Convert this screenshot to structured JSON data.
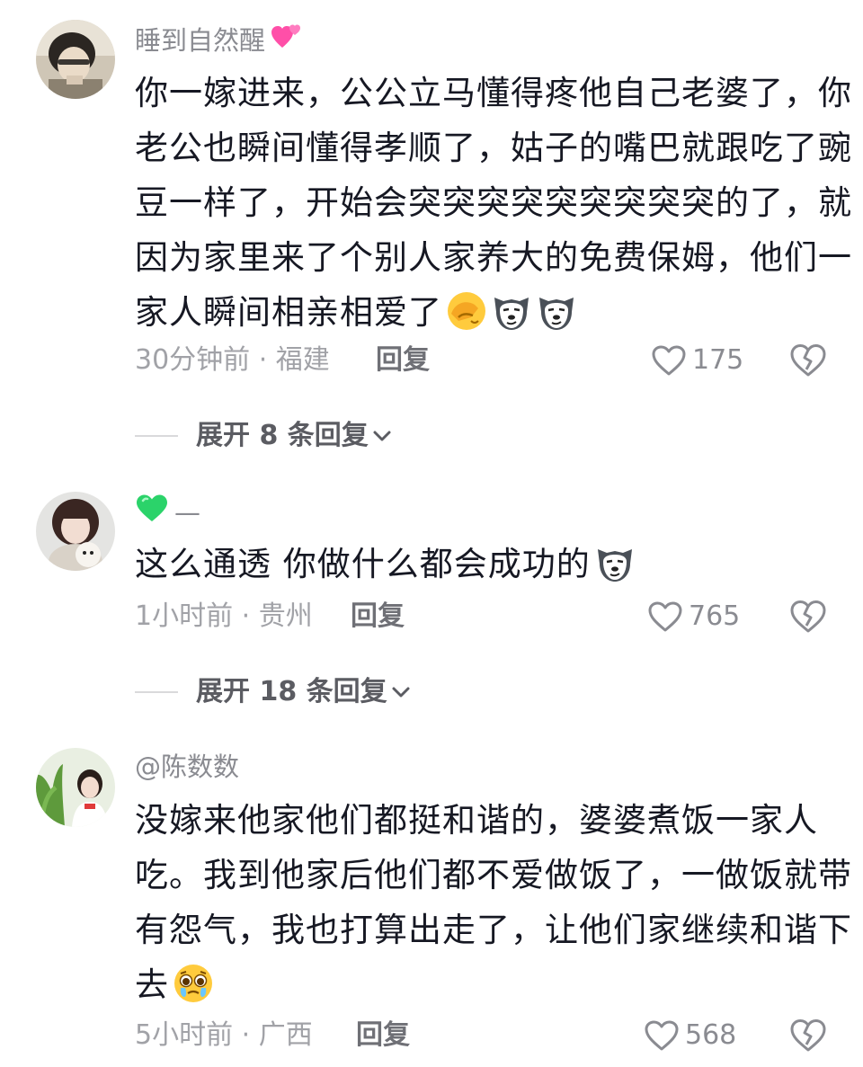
{
  "comments": [
    {
      "username": "睡到自然醒",
      "username_emoji": "two-hearts-icon",
      "lines": [
        "你一嫁进来，公公立马懂得疼他自己老婆了，你",
        "老公也瞬间懂得孝顺了，姑子的嘴巴就跟吃了豌",
        "豆一样了，开始会突突突突突突突突突的了，就",
        "因为家里来了个别人家养大的免费保姆，他们一",
        "家人瞬间相亲相爱了"
      ],
      "trailing_emojis": [
        "facepalm-icon",
        "wolf-smirk-icon",
        "wolf-smirk-icon"
      ],
      "meta": "30分钟前 · 福建",
      "reply_label": "回复",
      "likes": "175",
      "expand_label": "展开 8 条回复"
    },
    {
      "username": "—",
      "username_emoji": "green-heart-icon",
      "lines": [
        "这么通透 你做什么都会成功的"
      ],
      "trailing_emojis": [
        "wolf-smirk-icon"
      ],
      "meta": "1小时前 · 贵州",
      "reply_label": "回复",
      "likes": "765",
      "expand_label": "展开 18 条回复"
    },
    {
      "username": "@陈数数",
      "username_emoji": "",
      "lines": [
        "没嫁来他家他们都挺和谐的，婆婆煮饭一家人",
        "吃。我到他家后他们都不爱做饭了，一做饭就带",
        "有怨气，我也打算出走了，让他们家继续和谐下",
        "去"
      ],
      "trailing_emojis": [
        "pleading-tears-icon"
      ],
      "meta": "5小时前 · 广西",
      "reply_label": "回复",
      "likes": "568"
    }
  ],
  "colors": {
    "text": "#161823",
    "username": "#8a8b91",
    "meta": "#a1a2a7",
    "reply": "#6f7076",
    "icon": "#8a8b91"
  }
}
